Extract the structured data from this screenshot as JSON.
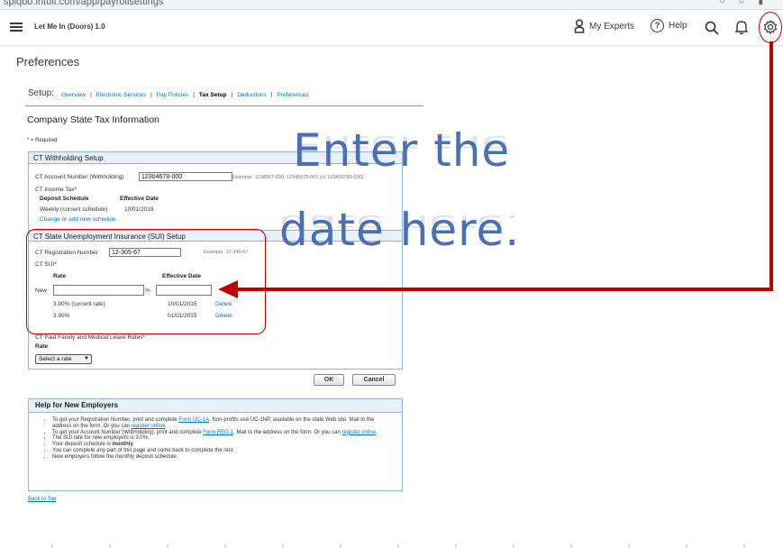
{
  "browser": {
    "url": "spiqbo.intuit.com/app/payrollsettings"
  },
  "topbar": {
    "app_title": "Let Me In (Doors) 1.0",
    "my_experts": "My Experts",
    "help": "Help"
  },
  "page": {
    "title": "Preferences"
  },
  "setup": {
    "label": "Setup:",
    "links": [
      "Overview",
      "Electronic Services",
      "Pay Policies",
      "Tax Setup",
      "Deductions",
      "Preferences"
    ],
    "separator": "|"
  },
  "form": {
    "title": "Company State Tax Information",
    "required_note": "* = Required",
    "withholding": {
      "header": "CT Withholding Setup",
      "account_label": "CT Account Number (Withholding)",
      "account_value": "12304678-000",
      "account_example": "Example: 1234567-000, 12345678-000 (or 123456789-000)",
      "income_tax_label": "CT Income Tax*",
      "deposit_schedule_header": "Deposit Schedule",
      "effective_date_header": "Effective Date",
      "schedule_value": "Weekly (current schedule)",
      "schedule_date": "10/01/2019",
      "change_link": "Change or add new schedule."
    },
    "sui": {
      "header": "CT State Unemployment Insurance (SUI) Setup",
      "registration_label": "CT Registration Number",
      "registration_value": "12-305-67",
      "registration_example": "Example: 12-345-67",
      "sui_label": "CT SUI*",
      "rate_header": "Rate",
      "effective_date_header": "Effective Date",
      "new_label": "New",
      "new_rate_value": "",
      "new_date_value": "",
      "percent": "%",
      "rows": [
        {
          "rate": "3.90% (current rate)",
          "date": "10/01/2015",
          "action": "Delete"
        },
        {
          "rate": "3.90%",
          "date": "01/01/2015",
          "action": "Delete"
        }
      ]
    },
    "pfml": {
      "label": "CT Paid Family and Medical Leave Rates*",
      "rate_header": "Rate",
      "select_value": "Select a rate"
    },
    "ok_label": "OK",
    "cancel_label": "Cancel"
  },
  "help": {
    "header": "Help for New Employers",
    "items": [
      {
        "pre": "To get your Registration Number, print and complete ",
        "link1": "Form UC-1A",
        "mid": ". Non-profits use UC-1NP, available on the state Web site. Mail to the address on the form. Or you can ",
        "link2": "register online",
        "post": "."
      },
      {
        "pre": "To get your Account Number (Withholding), print and complete ",
        "link1": "Form REG-1",
        "mid": ". Mail to the address on the form. Or you can ",
        "link2": "register online",
        "post": "."
      },
      {
        "text": "The SUI rate for new employers is 3.0%."
      },
      {
        "pre": "Your deposit schedule is ",
        "bold": "monthly"
      },
      {
        "text": "You can complete any part of this page and come back to complete the rest."
      },
      {
        "text": "New employers follow the monthly deposit schedule."
      }
    ]
  },
  "back_to_top": "Back to Top",
  "annotation": {
    "line1": "Enter the",
    "line2": "date here.",
    "color": "#c00000"
  }
}
